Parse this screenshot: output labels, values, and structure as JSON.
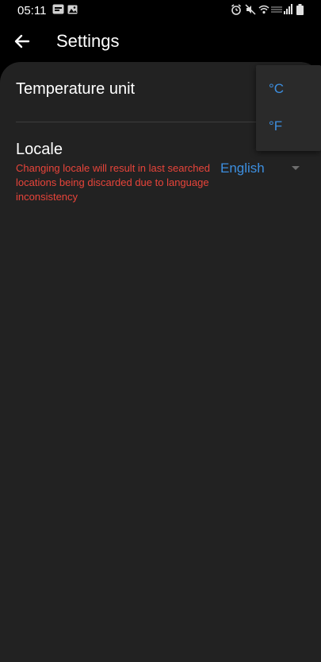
{
  "status_bar": {
    "time": "05:11",
    "icons": [
      "notification-icon",
      "image-icon",
      "alarm-icon",
      "mute-icon",
      "wifi-icon",
      "signal-icon",
      "signal-bars-icon",
      "battery-icon"
    ]
  },
  "app_bar": {
    "title": "Settings",
    "back_icon": "arrow-back-icon"
  },
  "settings": {
    "temperature_unit": {
      "label": "Temperature unit",
      "options": [
        "°C",
        "°F"
      ]
    },
    "locale": {
      "label": "Locale",
      "warning": "Changing locale will result in last searched locations being discarded due to language inconsistency",
      "value": "English"
    }
  },
  "colors": {
    "background": "#000000",
    "surface": "#222222",
    "accent": "#3d8fe0",
    "warning": "#e8443a"
  }
}
